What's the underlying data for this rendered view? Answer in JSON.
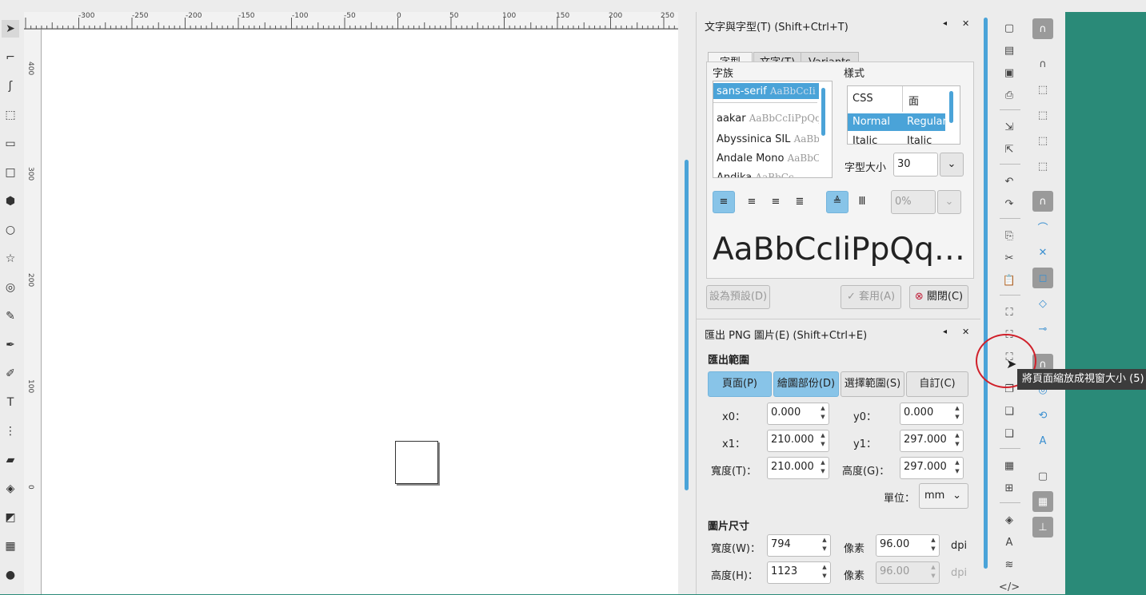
{
  "ruler": {
    "top_ticks": [
      "-300",
      "-250",
      "-200",
      "-150",
      "-100",
      "-50",
      "0",
      "50",
      "100",
      "150",
      "200",
      "250"
    ],
    "left_ticks": [
      "400",
      "300",
      "200",
      "100",
      "0"
    ]
  },
  "text_panel": {
    "title": "文字與字型(T) (Shift+Ctrl+T)",
    "tabs": [
      "字型(F)",
      "文字(T)",
      "Variants"
    ],
    "family_label": "字族",
    "style_label": "樣式",
    "families": [
      {
        "name": "sans-serif",
        "sample": "AaBbCcIi"
      },
      {
        "name": "aakar",
        "sample": "AaBbCcIiPpQq"
      },
      {
        "name": "Abyssinica SIL",
        "sample": "AaBb"
      },
      {
        "name": "Andale Mono",
        "sample": "AaBbC"
      },
      {
        "name": "Andika",
        "sample": "AaBbCc"
      }
    ],
    "style_headers": [
      "CSS",
      "面"
    ],
    "styles": [
      {
        "css": "Normal",
        "face": "Regular"
      },
      {
        "css": "Italic",
        "face": "Italic"
      }
    ],
    "size_label": "字型大小",
    "size_value": "30",
    "spacing_value": "0%",
    "preview": "AaBbCcIiPpQq…",
    "set_default": "設為預設(D)",
    "apply": "套用(A)",
    "close": "關閉(C)"
  },
  "export_panel": {
    "title": "匯出 PNG 圖片(E) (Shift+Ctrl+E)",
    "area_label": "匯出範圍",
    "area_buttons": [
      "頁面(P)",
      "繪圖部份(D)",
      "選擇範圍(S)",
      "自訂(C)"
    ],
    "x0_label": "x0：",
    "x0": "0.000",
    "y0_label": "y0：",
    "y0": "0.000",
    "x1_label": "x1：",
    "x1": "210.000",
    "y1_label": "y1：",
    "y1": "297.000",
    "width_label": "寬度(T)：",
    "width": "210.000",
    "height_label": "高度(G)：",
    "height": "297.000",
    "unit_label": "單位：",
    "unit": "mm",
    "image_size_label": "圖片尺寸",
    "img_width_label": "寬度(W)：",
    "img_width": "794",
    "img_height_label": "高度(H)：",
    "img_height": "1123",
    "pixel_label": "像素",
    "dpi_value": "96.00",
    "dpi_value_disabled": "96.00",
    "dpi_label": "dpi"
  },
  "tooltip": "將頁面縮放成視窗大小 (5)"
}
